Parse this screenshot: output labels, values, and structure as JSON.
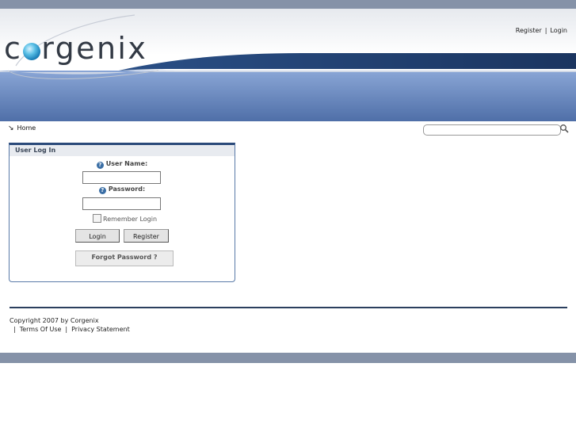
{
  "header": {
    "brand": "corgenix",
    "register_link": "Register",
    "login_link": "Login",
    "separator": "|"
  },
  "breadcrumb": {
    "home": "Home"
  },
  "search": {
    "value": "",
    "icon": "search-icon"
  },
  "login_panel": {
    "title": "User Log In",
    "username_label": "User Name:",
    "password_label": "Password:",
    "remember_label": "Remember Login",
    "login_button": "Login",
    "register_button": "Register",
    "forgot_button": "Forgot Password ?"
  },
  "footer": {
    "copyright": "Copyright 2007 by Corgenix",
    "terms": "Terms Of Use",
    "privacy": "Privacy Statement",
    "separator": "|"
  },
  "colors": {
    "banner_dark": "#1f3a64",
    "banner_blue": "#6f8fc4",
    "strip": "#8592a8"
  }
}
